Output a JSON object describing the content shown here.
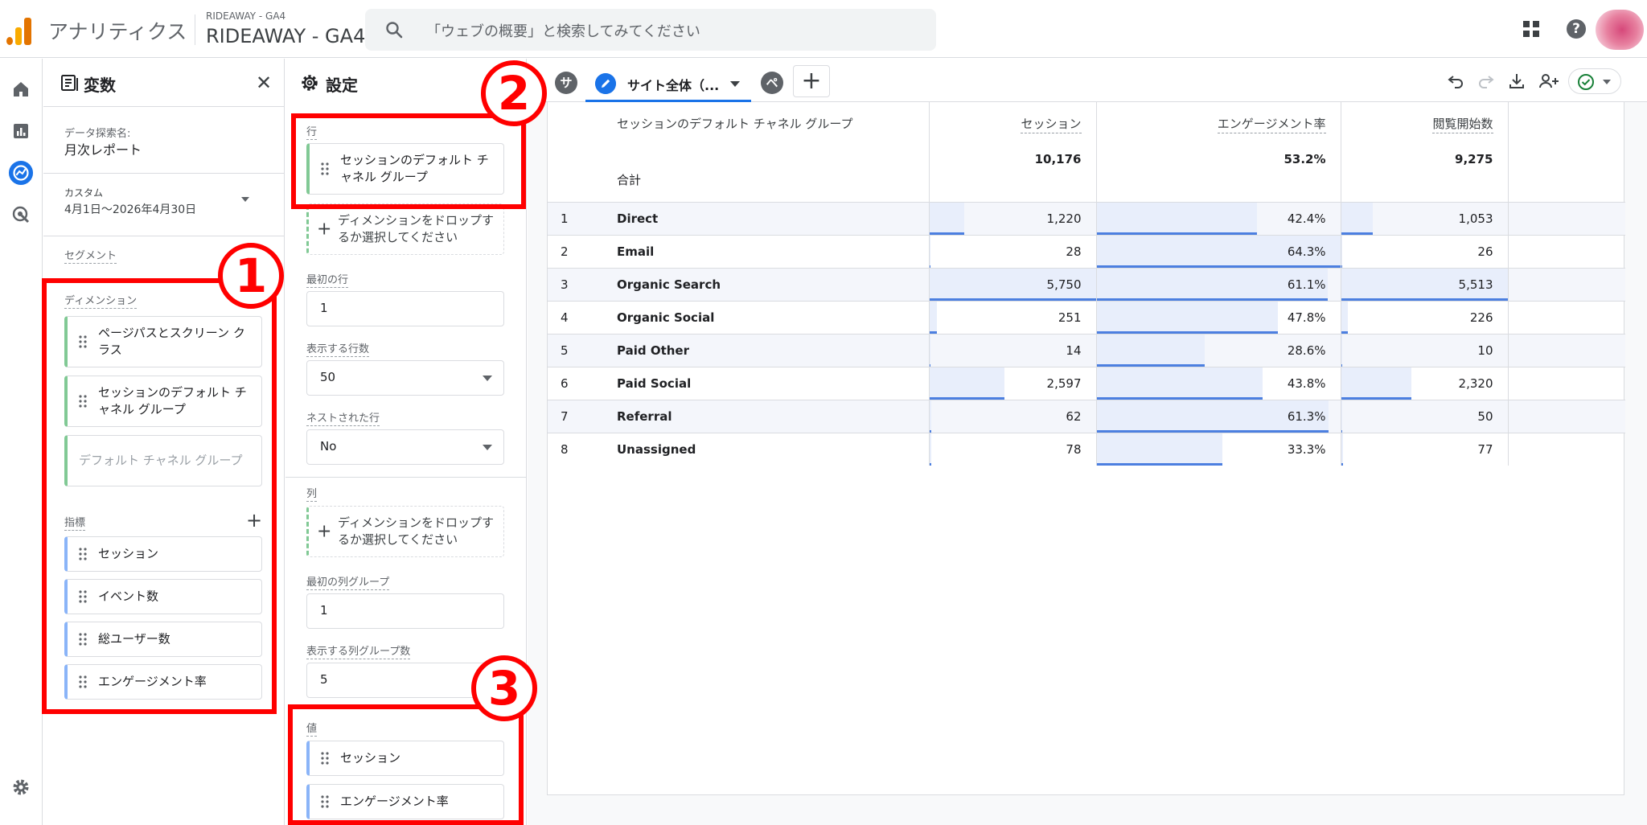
{
  "topbar": {
    "app_name": "アナリティクス",
    "account_small": "RIDEAWAY - GA4",
    "account_big": "RIDEAWAY - GA4",
    "search_placeholder": "「ウェブの概要」と検索してみてください"
  },
  "rail": {
    "icons": [
      "home-icon",
      "reports-icon",
      "explore-icon",
      "advertising-icon",
      "gear-icon"
    ]
  },
  "variables": {
    "title": "変数",
    "exploration_name_label": "データ探索名:",
    "exploration_name": "月次レポート",
    "date_label": "カスタム",
    "date_value": "4月1日～2026年4月30日",
    "segments_label": "セグメント",
    "dimensions_label": "ディメンション",
    "dimensions": [
      "ページパスとスクリーン クラス",
      "セッションのデフォルト チャネル グループ"
    ],
    "dimension_placeholder": "デフォルト チャネル グループ",
    "metrics_label": "指標",
    "metrics": [
      "セッション",
      "イベント数",
      "総ユーザー数",
      "エンゲージメント率"
    ]
  },
  "settings": {
    "title": "設定",
    "rows_label": "行",
    "rows_item": "セッションのデフォルト チャネル グループ",
    "rows_drop": "ディメンションをドロップするか選択してください",
    "first_row_label": "最初の行",
    "first_row_value": "1",
    "show_rows_label": "表示する行数",
    "show_rows_value": "50",
    "nested_rows_label": "ネストされた行",
    "nested_rows_value": "No",
    "columns_label": "列",
    "columns_drop": "ディメンションをドロップするか選択してください",
    "first_col_group_label": "最初の列グループ",
    "first_col_group_value": "1",
    "show_col_groups_label": "表示する列グループ数",
    "show_col_groups_value": "5",
    "values_label": "値",
    "values": [
      "セッション",
      "エンゲージメント率"
    ]
  },
  "tabs": {
    "s_badge": "サ",
    "active_label": "サイト全体（...",
    "pe_badge": "ペ",
    "add": "+"
  },
  "table": {
    "dim_header": "セッションのデフォルト チャネル グループ",
    "metric_headers": [
      "セッション",
      "エンゲージメント率",
      "閲覧開始数"
    ],
    "total_label": "合計",
    "totals": [
      "10,176",
      "53.2%",
      "9,275"
    ],
    "rows": [
      {
        "idx": "1",
        "name": "Direct",
        "sessions": "1,220",
        "sessions_frac": 0.212,
        "eng": "42.4%",
        "eng_frac": 0.66,
        "views": "1,053",
        "views_frac": 0.191
      },
      {
        "idx": "2",
        "name": "Email",
        "sessions": "28",
        "sessions_frac": 0.005,
        "eng": "64.3%",
        "eng_frac": 1.0,
        "views": "26",
        "views_frac": 0.005
      },
      {
        "idx": "3",
        "name": "Organic Search",
        "sessions": "5,750",
        "sessions_frac": 1.0,
        "eng": "61.1%",
        "eng_frac": 0.95,
        "views": "5,513",
        "views_frac": 1.0
      },
      {
        "idx": "4",
        "name": "Organic Social",
        "sessions": "251",
        "sessions_frac": 0.044,
        "eng": "47.8%",
        "eng_frac": 0.743,
        "views": "226",
        "views_frac": 0.041
      },
      {
        "idx": "5",
        "name": "Paid Other",
        "sessions": "14",
        "sessions_frac": 0.002,
        "eng": "28.6%",
        "eng_frac": 0.445,
        "views": "10",
        "views_frac": 0.002
      },
      {
        "idx": "6",
        "name": "Paid Social",
        "sessions": "2,597",
        "sessions_frac": 0.452,
        "eng": "43.8%",
        "eng_frac": 0.681,
        "views": "2,320",
        "views_frac": 0.421
      },
      {
        "idx": "7",
        "name": "Referral",
        "sessions": "62",
        "sessions_frac": 0.011,
        "eng": "61.3%",
        "eng_frac": 0.953,
        "views": "50",
        "views_frac": 0.009
      },
      {
        "idx": "8",
        "name": "Unassigned",
        "sessions": "78",
        "sessions_frac": 0.014,
        "eng": "33.3%",
        "eng_frac": 0.518,
        "views": "77",
        "views_frac": 0.014
      }
    ]
  },
  "annotations": [
    "1",
    "2",
    "3"
  ],
  "colors": {
    "accent": "#1a73e8",
    "annotation": "#ff0000",
    "dimension_chip": "#81c995",
    "metric_chip": "#8ab4f8",
    "bar": "#4c7fe0"
  }
}
